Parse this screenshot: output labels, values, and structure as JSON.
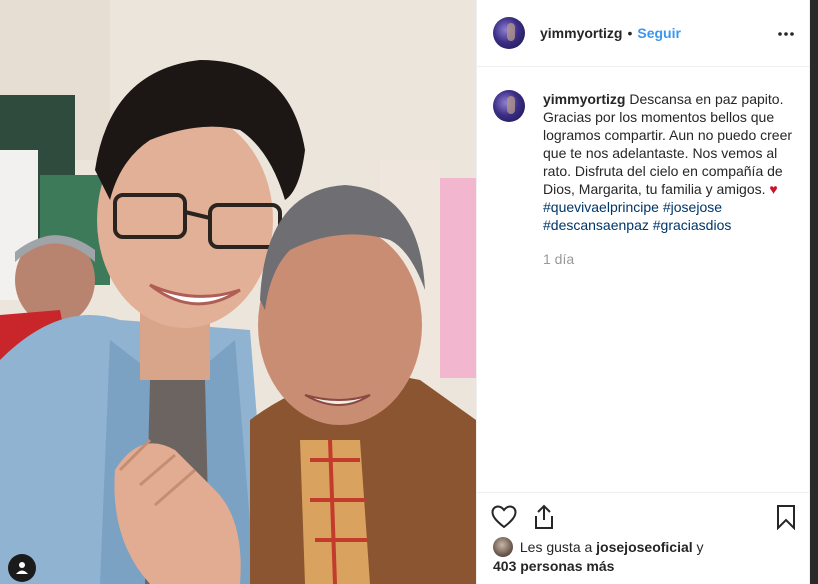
{
  "post": {
    "username": "yimmyortizg",
    "separator": "•",
    "follow_label": "Seguir",
    "caption_text": "Descansa en paz papito. Gracias por los momentos bellos que logramos compartir. Aun no puedo creer que te nos adelantaste. Nos vemos al rato. Disfruta del cielo en compañía de Dios, Margarita, tu familia y amigos.",
    "caption_emoji": "♥",
    "hashtags": [
      "#quevivaelprincipe",
      "#josejose",
      "#descansaenpaz",
      "#graciasdios"
    ],
    "time_ago": "1 día",
    "likes_prefix": "Les gusta a",
    "likes_user": "josejoseoficial",
    "likes_conjunction": "y",
    "likes_others": "403 personas más"
  },
  "icons": {
    "more": "more-options-icon",
    "like": "heart-outline-icon",
    "share": "share-icon",
    "save": "bookmark-icon",
    "tagged_users": "user-tag-icon"
  },
  "colors": {
    "link_blue": "#3897f0",
    "hashtag_blue": "#003569",
    "muted_gray": "#999999",
    "heart_red": "#d0112b"
  }
}
